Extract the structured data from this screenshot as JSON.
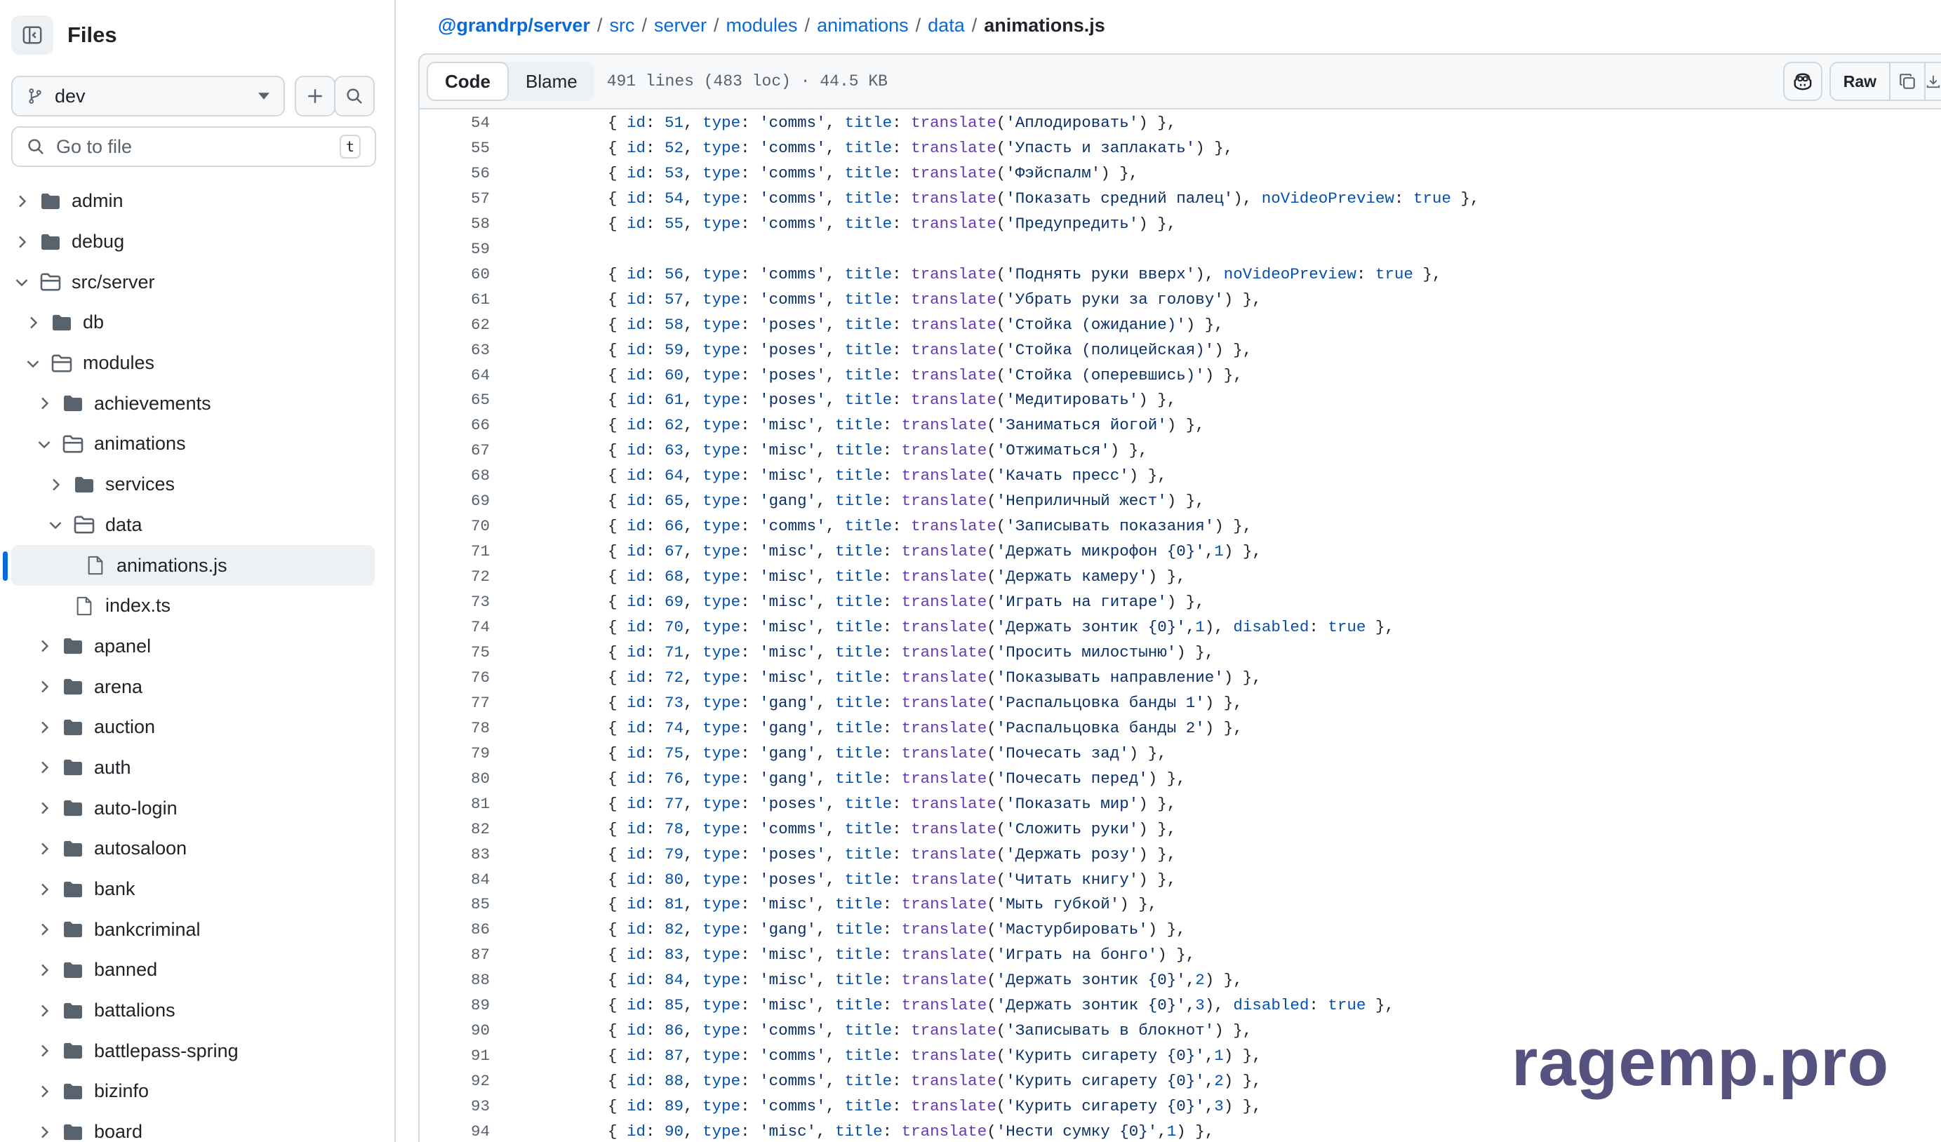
{
  "sidebar": {
    "title": "Files",
    "branch": "dev",
    "goto_placeholder": "Go to file",
    "goto_shortcut": "t",
    "tree": [
      {
        "label": "admin",
        "type": "folder",
        "depth": 0,
        "expanded": false
      },
      {
        "label": "debug",
        "type": "folder",
        "depth": 0,
        "expanded": false
      },
      {
        "label": "src/server",
        "type": "folder",
        "depth": 0,
        "expanded": true
      },
      {
        "label": "db",
        "type": "folder",
        "depth": 1,
        "expanded": false
      },
      {
        "label": "modules",
        "type": "folder",
        "depth": 1,
        "expanded": true
      },
      {
        "label": "achievements",
        "type": "folder",
        "depth": 2,
        "expanded": false
      },
      {
        "label": "animations",
        "type": "folder",
        "depth": 2,
        "expanded": true
      },
      {
        "label": "services",
        "type": "folder",
        "depth": 3,
        "expanded": false
      },
      {
        "label": "data",
        "type": "folder",
        "depth": 3,
        "expanded": true
      },
      {
        "label": "animations.js",
        "type": "file",
        "depth": 4,
        "selected": true
      },
      {
        "label": "index.ts",
        "type": "file",
        "depth": 3
      },
      {
        "label": "apanel",
        "type": "folder",
        "depth": 2,
        "expanded": false
      },
      {
        "label": "arena",
        "type": "folder",
        "depth": 2,
        "expanded": false
      },
      {
        "label": "auction",
        "type": "folder",
        "depth": 2,
        "expanded": false
      },
      {
        "label": "auth",
        "type": "folder",
        "depth": 2,
        "expanded": false
      },
      {
        "label": "auto-login",
        "type": "folder",
        "depth": 2,
        "expanded": false
      },
      {
        "label": "autosaloon",
        "type": "folder",
        "depth": 2,
        "expanded": false
      },
      {
        "label": "bank",
        "type": "folder",
        "depth": 2,
        "expanded": false
      },
      {
        "label": "bankcriminal",
        "type": "folder",
        "depth": 2,
        "expanded": false
      },
      {
        "label": "banned",
        "type": "folder",
        "depth": 2,
        "expanded": false
      },
      {
        "label": "battalions",
        "type": "folder",
        "depth": 2,
        "expanded": false
      },
      {
        "label": "battlepass-spring",
        "type": "folder",
        "depth": 2,
        "expanded": false
      },
      {
        "label": "bizinfo",
        "type": "folder",
        "depth": 2,
        "expanded": false
      },
      {
        "label": "board",
        "type": "folder",
        "depth": 2,
        "expanded": false
      }
    ]
  },
  "breadcrumb": {
    "owner": "@grandrp/server",
    "parts": [
      "src",
      "server",
      "modules",
      "animations",
      "data"
    ],
    "current": "animations.js"
  },
  "file_header": {
    "tab_code": "Code",
    "tab_blame": "Blame",
    "meta": "491 lines (483 loc) · 44.5 KB",
    "raw_label": "Raw"
  },
  "code_lines": [
    {
      "n": "54",
      "id": "51",
      "type": "comms",
      "title": "Аплодировать",
      "extra": ""
    },
    {
      "n": "55",
      "id": "52",
      "type": "comms",
      "title": "Упасть и заплакать",
      "extra": ""
    },
    {
      "n": "56",
      "id": "53",
      "type": "comms",
      "title": "Фэйспалм",
      "extra": ""
    },
    {
      "n": "57",
      "id": "54",
      "type": "comms",
      "title": "Показать средний палец",
      "extra": "noVideoPreview"
    },
    {
      "n": "58",
      "id": "55",
      "type": "comms",
      "title": "Предупредить",
      "extra": ""
    },
    {
      "n": "59",
      "blank": true
    },
    {
      "n": "60",
      "id": "56",
      "type": "comms",
      "title": "Поднять руки вверх",
      "extra": "noVideoPreview"
    },
    {
      "n": "61",
      "id": "57",
      "type": "comms",
      "title": "Убрать руки за голову",
      "extra": ""
    },
    {
      "n": "62",
      "id": "58",
      "type": "poses",
      "title": "Стойка (ожидание)",
      "extra": ""
    },
    {
      "n": "63",
      "id": "59",
      "type": "poses",
      "title": "Стойка (полицейская)",
      "extra": ""
    },
    {
      "n": "64",
      "id": "60",
      "type": "poses",
      "title": "Стойка (оперевшись)",
      "extra": ""
    },
    {
      "n": "65",
      "id": "61",
      "type": "poses",
      "title": "Медитировать",
      "extra": ""
    },
    {
      "n": "66",
      "id": "62",
      "type": "misc",
      "title": "Заниматься йогой",
      "extra": ""
    },
    {
      "n": "67",
      "id": "63",
      "type": "misc",
      "title": "Отжиматься",
      "extra": ""
    },
    {
      "n": "68",
      "id": "64",
      "type": "misc",
      "title": "Качать пресс",
      "extra": ""
    },
    {
      "n": "69",
      "id": "65",
      "type": "gang",
      "title": "Неприличный жест",
      "extra": ""
    },
    {
      "n": "70",
      "id": "66",
      "type": "comms",
      "title": "Записывать показания",
      "extra": ""
    },
    {
      "n": "71",
      "id": "67",
      "type": "misc",
      "title": "Держать микрофон {0}",
      "arg": "1",
      "extra": ""
    },
    {
      "n": "72",
      "id": "68",
      "type": "misc",
      "title": "Держать камеру",
      "extra": ""
    },
    {
      "n": "73",
      "id": "69",
      "type": "misc",
      "title": "Играть на гитаре",
      "extra": ""
    },
    {
      "n": "74",
      "id": "70",
      "type": "misc",
      "title": "Держать зонтик {0}",
      "arg": "1",
      "extra": "disabled"
    },
    {
      "n": "75",
      "id": "71",
      "type": "misc",
      "title": "Просить милостыню",
      "extra": ""
    },
    {
      "n": "76",
      "id": "72",
      "type": "misc",
      "title": "Показывать направление",
      "extra": ""
    },
    {
      "n": "77",
      "id": "73",
      "type": "gang",
      "title": "Распальцовка банды 1",
      "extra": ""
    },
    {
      "n": "78",
      "id": "74",
      "type": "gang",
      "title": "Распальцовка банды 2",
      "extra": ""
    },
    {
      "n": "79",
      "id": "75",
      "type": "gang",
      "title": "Почесать зад",
      "extra": ""
    },
    {
      "n": "80",
      "id": "76",
      "type": "gang",
      "title": "Почесать перед",
      "extra": ""
    },
    {
      "n": "81",
      "id": "77",
      "type": "poses",
      "title": "Показать мир",
      "extra": ""
    },
    {
      "n": "82",
      "id": "78",
      "type": "comms",
      "title": "Сложить руки",
      "extra": ""
    },
    {
      "n": "83",
      "id": "79",
      "type": "poses",
      "title": "Держать розу",
      "extra": ""
    },
    {
      "n": "84",
      "id": "80",
      "type": "poses",
      "title": "Читать книгу",
      "extra": ""
    },
    {
      "n": "85",
      "id": "81",
      "type": "misc",
      "title": "Мыть губкой",
      "extra": ""
    },
    {
      "n": "86",
      "id": "82",
      "type": "gang",
      "title": "Мастурбировать",
      "extra": ""
    },
    {
      "n": "87",
      "id": "83",
      "type": "misc",
      "title": "Играть на бонго",
      "extra": ""
    },
    {
      "n": "88",
      "id": "84",
      "type": "misc",
      "title": "Держать зонтик {0}",
      "arg": "2",
      "extra": ""
    },
    {
      "n": "89",
      "id": "85",
      "type": "misc",
      "title": "Держать зонтик {0}",
      "arg": "3",
      "extra": "disabled"
    },
    {
      "n": "90",
      "id": "86",
      "type": "comms",
      "title": "Записывать в блокнот",
      "extra": ""
    },
    {
      "n": "91",
      "id": "87",
      "type": "comms",
      "title": "Курить сигарету {0}",
      "arg": "1",
      "extra": ""
    },
    {
      "n": "92",
      "id": "88",
      "type": "comms",
      "title": "Курить сигарету {0}",
      "arg": "2",
      "extra": ""
    },
    {
      "n": "93",
      "id": "89",
      "type": "comms",
      "title": "Курить сигарету {0}",
      "arg": "3",
      "extra": ""
    },
    {
      "n": "94",
      "id": "90",
      "type": "misc",
      "title": "Нести сумку {0}",
      "arg": "1",
      "extra": ""
    }
  ],
  "watermark": "ragemp.pro"
}
